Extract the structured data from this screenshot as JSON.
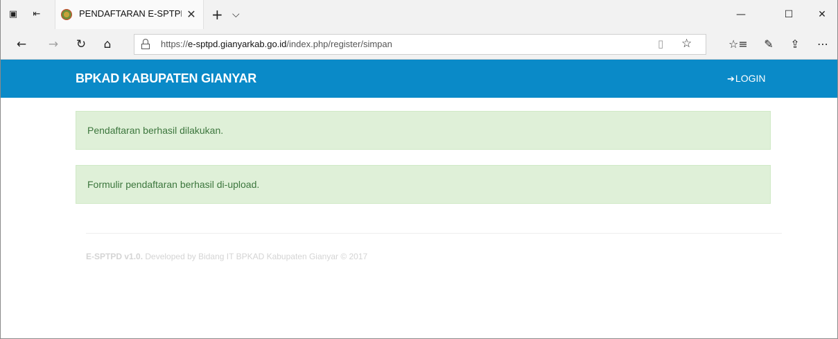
{
  "browser": {
    "tab_title": "PENDAFTARAN E-SPTPD",
    "tab_close": "✕",
    "new_tab": "+",
    "tab_list": "⌵",
    "window_controls": {
      "minimize": "—",
      "maximize": "☐",
      "close": "✕"
    },
    "nav": {
      "back": "←",
      "forward": "→",
      "refresh": "↻",
      "home": "⌂"
    },
    "url_prefix": "https://",
    "url_host": "e-sptpd.gianyarkab.go.id",
    "url_path": "/index.php/register/simpan",
    "toolbar": {
      "reading_view": "▯",
      "favorite": "☆",
      "favorites_hub": "☆≡",
      "notes": "✎",
      "share": "⇪",
      "more": "⋯"
    }
  },
  "header": {
    "brand": "BPKAD KABUPATEN GIANYAR",
    "login_icon": "➔",
    "login_label": "LOGIN"
  },
  "alerts": [
    {
      "text": "Pendaftaran berhasil dilakukan."
    },
    {
      "text": "Formulir pendaftaran berhasil di-upload."
    }
  ],
  "footer": {
    "version": "E-SPTPD v1.0.",
    "credit": " Developed by Bidang IT BPKAD Kabupaten Gianyar © 2017"
  },
  "colors": {
    "header_bg": "#0a8ac8",
    "alert_bg": "#dff0d8",
    "alert_text": "#3c763d"
  }
}
